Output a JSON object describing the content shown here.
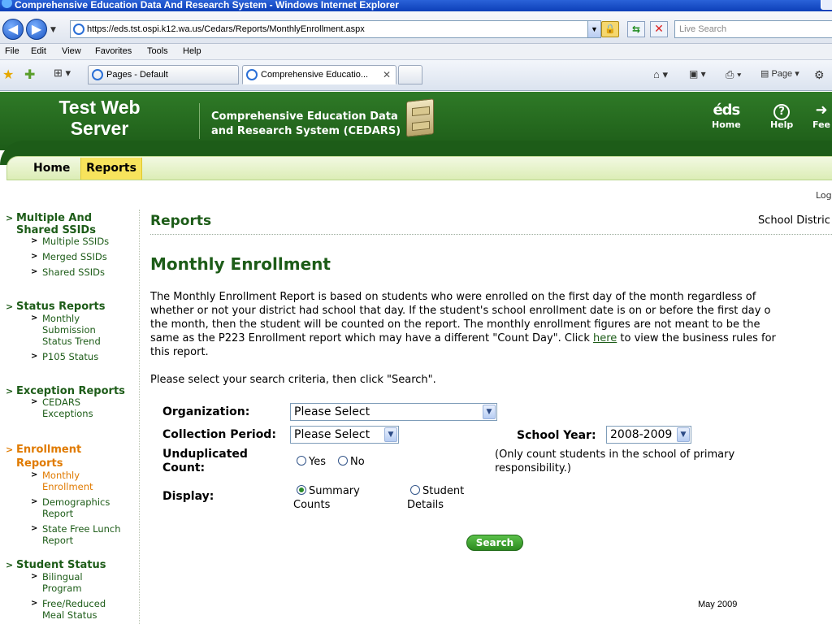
{
  "browser": {
    "window_title": "Comprehensive Education Data And Research System - Windows Internet Explorer",
    "url": "https://eds.tst.ospi.k12.wa.us/Cedars/Reports/MonthlyEnrollment.aspx",
    "live_search_placeholder": "Live Search",
    "menu": [
      "File",
      "Edit",
      "View",
      "Favorites",
      "Tools",
      "Help"
    ],
    "tabs": [
      {
        "label": "Pages - Default"
      },
      {
        "label": "Comprehensive Educatio..."
      }
    ],
    "tools": {
      "page": "Page"
    }
  },
  "header": {
    "brand_line1": "Test Web",
    "brand_line2": "Server",
    "title_line1": "Comprehensive Education Data",
    "title_line2": "and Research System (CEDARS)",
    "links": [
      {
        "icon": "eds",
        "label": "Home"
      },
      {
        "icon": "?",
        "label": "Help"
      },
      {
        "label": "Fee"
      }
    ]
  },
  "site_tabs": {
    "home": "Home",
    "reports": "Reports"
  },
  "logout_fragment": "Log",
  "sidebar": {
    "groups": [
      {
        "title_l1": "Multiple And",
        "title_l2": "Shared SSIDs",
        "items": [
          "Multiple SSIDs",
          "Merged SSIDs",
          "Shared SSIDs"
        ]
      },
      {
        "title": "Status Reports",
        "items": [
          {
            "l1": "Monthly",
            "l2": "Submission",
            "l3": "Status Trend"
          },
          "P105 Status"
        ]
      },
      {
        "title": "Exception Reports",
        "items": [
          {
            "l1": "CEDARS",
            "l2": "Exceptions"
          }
        ]
      },
      {
        "title_l1": "Enrollment",
        "title_l2": "Reports",
        "items": [
          {
            "l1": "Monthly",
            "l2": "Enrollment"
          },
          {
            "l1": "Demographics",
            "l2": "Report"
          },
          {
            "l1": "State Free Lunch",
            "l2": "Report"
          }
        ]
      },
      {
        "title": "Student Status",
        "items": [
          {
            "l1": "Bilingual",
            "l2": "Program"
          },
          {
            "l1": "Free/Reduced",
            "l2": "Meal Status"
          }
        ]
      }
    ]
  },
  "main": {
    "section_title": "Reports",
    "district_label": "School Distric",
    "page_title": "Monthly Enrollment",
    "desc_lines": [
      "The Monthly Enrollment Report is based on students who were enrolled on the first day of the month regardless of",
      "whether or not your district had school that day. If the student's school enrollment date is on or before the first day o",
      "the month, then the student will be counted on the report. The monthly enrollment figures are not meant to be the",
      "same as the P223 Enrollment report which may have a different \"Count Day\". Click "
    ],
    "desc_link": "here",
    "desc_after_link": " to view the business rules for",
    "desc_last": "this report.",
    "prompt": "Please select your search criteria, then click \"Search\".",
    "form": {
      "organization_label": "Organization:",
      "organization_value": "Please Select",
      "period_label": "Collection Period:",
      "period_value": "Please Select",
      "school_year_label": "School Year:",
      "school_year_value": "2008-2009",
      "undup_label_l1": "Unduplicated",
      "undup_label_l2": "Count:",
      "yes": "Yes",
      "no": "No",
      "undup_note_l1": "(Only count students in the school of primary",
      "undup_note_l2": "responsibility.)",
      "display_label": "Display:",
      "summary_l1": "Summary",
      "summary_l2": "Counts",
      "student_l1": "Student",
      "student_l2": "Details",
      "search_button": "Search"
    },
    "footer": "May 2009"
  }
}
